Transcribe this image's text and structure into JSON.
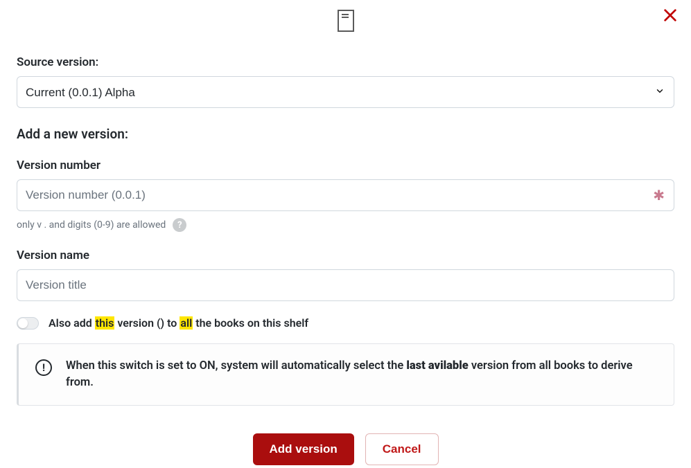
{
  "labels": {
    "source_version": "Source version:",
    "add_new_version": "Add a new version:",
    "version_number": "Version number",
    "version_name": "Version name"
  },
  "source_version_select": {
    "selected": "Current (0.0.1) Alpha"
  },
  "version_number_input": {
    "placeholder": "Version number (0.0.1)",
    "helper": "only v . and digits (0-9) are allowed"
  },
  "version_name_input": {
    "placeholder": "Version title"
  },
  "toggle": {
    "pre": "Also add ",
    "hl1": "this",
    "mid1": " version () to ",
    "hl2": "all",
    "post": " the books on this shelf"
  },
  "info": {
    "pre": "When this switch is set to ON, system will automatically select the ",
    "bold": "last avilable",
    "post": " version from all books to derive from."
  },
  "buttons": {
    "add": "Add version",
    "cancel": "Cancel"
  },
  "help_glyph": "?",
  "info_glyph": "!"
}
